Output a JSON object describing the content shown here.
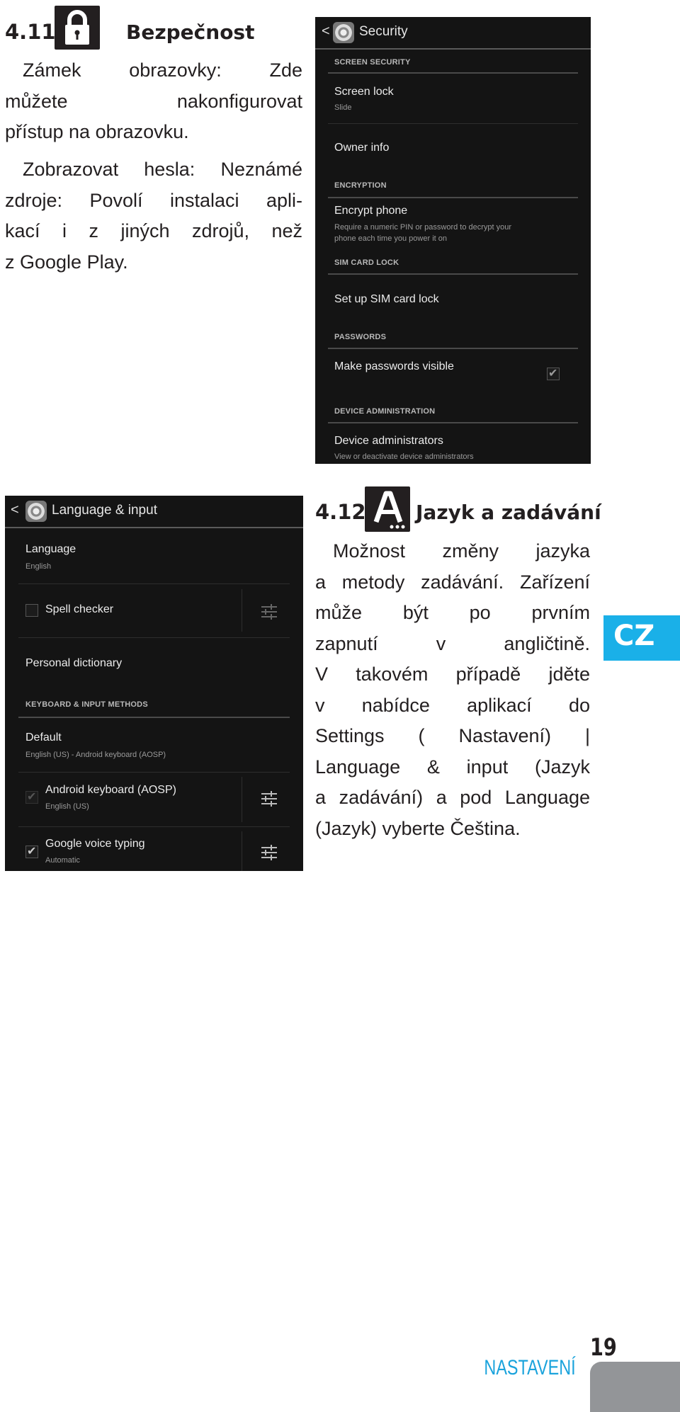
{
  "section_411": {
    "number": "4.11",
    "icon": "lock-icon",
    "title": "Bezpečnost",
    "paragraphs": [
      [
        "Zámek obrazovky: Zde",
        "můžete nakonfigurovat",
        "přístup na obrazovku."
      ],
      [
        "Zobrazovat hesla: Neznámé",
        "zdroje: Povolí instalaci apli-",
        "kací i z jiných zdrojů, než",
        "z Google Play."
      ]
    ]
  },
  "security_screen": {
    "back": "<",
    "title": "Security",
    "sections": {
      "screen_security": "SCREEN SECURITY",
      "encryption": "ENCRYPTION",
      "sim_card_lock": "SIM CARD LOCK",
      "passwords": "PASSWORDS",
      "device_administration": "DEVICE ADMINISTRATION"
    },
    "items": {
      "screen_lock": {
        "title": "Screen lock",
        "summary": "Slide"
      },
      "owner_info": {
        "title": "Owner info"
      },
      "encrypt_phone": {
        "title": "Encrypt phone",
        "summary_1": "Require a numeric PIN or password to decrypt your",
        "summary_2": "phone each time you power it on"
      },
      "sim_lock": {
        "title": "Set up SIM card lock"
      },
      "passwords_visible": {
        "title": "Make passwords visible",
        "checked": true
      },
      "device_admins": {
        "title": "Device administrators",
        "summary": "View or deactivate device administrators"
      }
    }
  },
  "language_screen": {
    "back": "<",
    "title": "Language & input",
    "items": {
      "language": {
        "title": "Language",
        "summary": "English"
      },
      "spell_checker": {
        "title": "Spell checker",
        "checked": false
      },
      "personal_dictionary": {
        "title": "Personal dictionary"
      },
      "keyboard_section": "KEYBOARD & INPUT METHODS",
      "default": {
        "title": "Default",
        "summary": "English (US) - Android keyboard (AOSP)"
      },
      "android_keyboard": {
        "title": "Android keyboard (AOSP)",
        "summary": "English (US)",
        "checked": true
      },
      "google_voice": {
        "title": "Google voice typing",
        "summary": "Automatic",
        "checked": true
      }
    }
  },
  "section_412": {
    "number": "4.12",
    "icon": "language-a-icon",
    "title": "Jazyk a zadávání",
    "paragraph": [
      "Možnost změny jazyka",
      "a metody zadávání. Zařízení",
      "může být po prvním",
      "zapnutí v angličtině.",
      "V takovém případě jděte",
      "v nabídce aplikací do",
      "Settings ( Nastavení) |",
      "Language & input (Jazyk",
      "a zadávání) a pod Language",
      "(Jazyk) vyberte Čeština."
    ]
  },
  "side_tab": {
    "label": "CZ",
    "color": "#1ab0e8"
  },
  "footer": {
    "chapter": "NASTAVENÍ",
    "page_number": "19",
    "chapter_color": "#1aa3dc",
    "tab_color": "#939598"
  }
}
